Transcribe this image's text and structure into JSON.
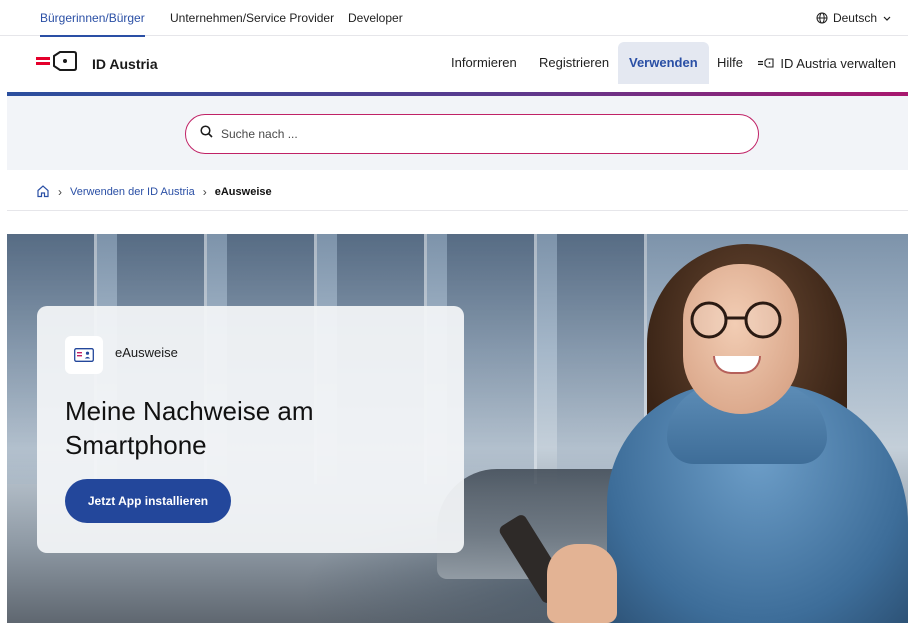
{
  "top_bar": {
    "audiences": [
      {
        "label": "Bürgerinnen/Bürger",
        "active": true
      },
      {
        "label": "Unternehmen/Service Provider",
        "active": false
      },
      {
        "label": "Developer",
        "active": false
      }
    ],
    "language": {
      "label": "Deutsch",
      "icon": "globe-icon"
    }
  },
  "header": {
    "logo_title": "ID Austria",
    "nav": [
      {
        "label": "Informieren",
        "active": false
      },
      {
        "label": "Registrieren",
        "active": false
      },
      {
        "label": "Verwenden",
        "active": true
      },
      {
        "label": "Hilfe",
        "active": false
      }
    ],
    "manage_label": "ID Austria verwalten",
    "accent_color": "#2a4fa5",
    "brand_red": "#e4002b"
  },
  "search": {
    "placeholder": "Suche nach ...",
    "border_color": "#c02266"
  },
  "breadcrumb": {
    "link": "Verwenden der ID Austria",
    "current": "eAusweise"
  },
  "hero": {
    "badge_label": "eAusweise",
    "title": "Meine Nachweise am Smartphone",
    "cta_label": "Jetzt App installieren",
    "cta_color": "#23479b"
  }
}
